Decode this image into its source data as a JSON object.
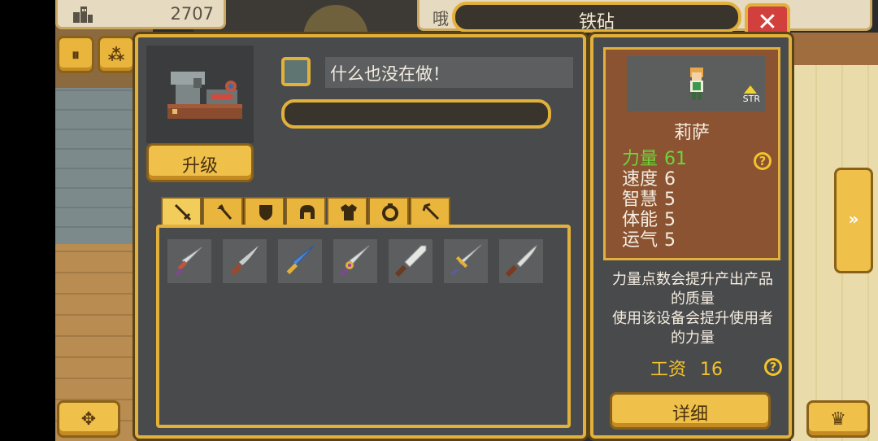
{
  "header": {
    "gold": "2707",
    "message": "哦",
    "title": "铁砧",
    "close_label": "✕"
  },
  "left_buttons": {
    "pause_label": "⏸",
    "group_label": "⁂"
  },
  "workshop": {
    "upgrade_label": "升级",
    "status_text": "什么也没在做！",
    "progress": 0,
    "tabs": [
      "sword-icon",
      "axe-icon",
      "shield-icon",
      "helmet-icon",
      "armor-icon",
      "ring-icon",
      "pickaxe-icon"
    ],
    "active_tab": 0,
    "items": [
      "dagger-icon",
      "knife-icon",
      "crystal-sword-icon",
      "jeweled-sword-icon",
      "broad-blade-icon",
      "long-sword-icon",
      "machete-icon"
    ]
  },
  "character": {
    "name": "莉萨",
    "badge": "STR",
    "stats": [
      {
        "label": "力量",
        "value": "61",
        "highlight": true
      },
      {
        "label": "速度",
        "value": "6",
        "highlight": false
      },
      {
        "label": "智慧",
        "value": "5",
        "highlight": false
      },
      {
        "label": "体能",
        "value": "5",
        "highlight": false
      },
      {
        "label": "运气",
        "value": "5",
        "highlight": false
      }
    ],
    "help_label": "?",
    "desc_line1": "力量点数会提升产出产品",
    "desc_line2": "的质量",
    "desc_line3": "使用该设备会提升使用者",
    "desc_line4": "的力量",
    "wage_label": "工资",
    "wage_value": "16",
    "detail_label": "详细"
  },
  "nav": {
    "next_label": "»",
    "dpad_label": "✥",
    "crown_label": "♛"
  },
  "colors": {
    "gold_border": "#e2b13c",
    "panel": "#494a4b",
    "highlight": "#6fd43a",
    "close": "#d1403c"
  }
}
